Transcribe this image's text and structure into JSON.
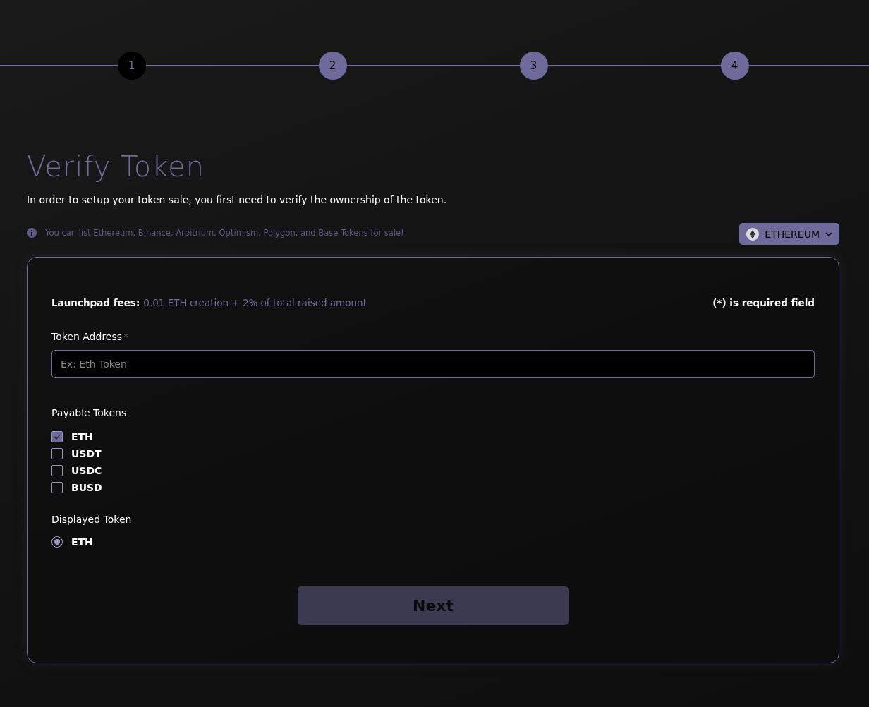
{
  "steps": [
    {
      "label": "1",
      "selected": true
    },
    {
      "label": "2",
      "selected": false
    },
    {
      "label": "3",
      "selected": false
    },
    {
      "label": "4",
      "selected": false
    }
  ],
  "title": "Verify Token",
  "subtitle": "In order to setup your token sale, you first need to verify the ownership of the token.",
  "info": "You can list Ethereum, Binance, Arbitrium, Optimism, Polygon, and Base Tokens for sale!",
  "network_select": {
    "value": "ETHEREUM"
  },
  "form": {
    "fees_label": "Launchpad fees:",
    "fees_value": "0.01 ETH creation + 2% of total raised amount",
    "required_note": "(*) is required field",
    "token_address": {
      "label": "Token Address",
      "required_mark": "*",
      "placeholder": "Ex: Eth Token"
    },
    "payable_tokens": {
      "label": "Payable Tokens",
      "options": [
        {
          "label": "ETH",
          "checked": true
        },
        {
          "label": "USDT",
          "checked": false
        },
        {
          "label": "USDC",
          "checked": false
        },
        {
          "label": "BUSD",
          "checked": false
        }
      ]
    },
    "displayed_token": {
      "label": "Displayed Token",
      "options": [
        {
          "label": "ETH",
          "selected": true
        }
      ]
    },
    "next_button": {
      "label": "Next",
      "disabled": true
    }
  }
}
